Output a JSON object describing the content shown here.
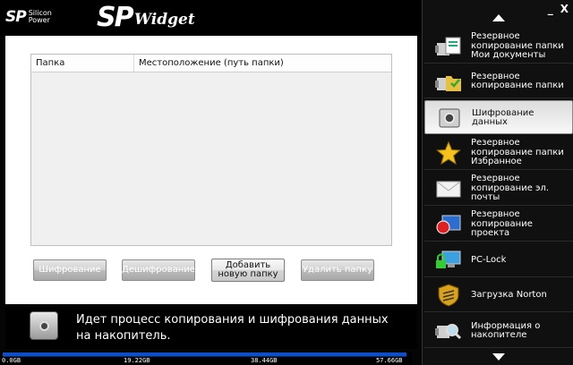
{
  "brand": {
    "logo": "SP",
    "logo_sub": "Silicon Power",
    "app_title": "SP",
    "app_title_widget": "Widget"
  },
  "window_controls": {
    "minimize": "_",
    "close": "X"
  },
  "table": {
    "columns": [
      "Папка",
      "Местоположение (путь папки)"
    ],
    "rows": []
  },
  "buttons": {
    "encrypt": "Шифрование",
    "decrypt": "Дешифрование",
    "add_folder": "Добавить новую папку",
    "delete_folder": "Удалить папку"
  },
  "status": {
    "message": "Идет процесс копирования и шифрования данных на накопитель."
  },
  "capacity": {
    "ticks": [
      "0.0GB",
      "19.22GB",
      "38.44GB",
      "57.66GB"
    ],
    "used_fraction": 0.98
  },
  "sidebar": {
    "items": [
      {
        "label": "Резервное копирование папки Мои документы",
        "icon": "usb-documents-icon"
      },
      {
        "label": "Резервное копирование папки",
        "icon": "usb-folder-icon"
      },
      {
        "label": "Шифрование данных",
        "icon": "safe-icon",
        "selected": true
      },
      {
        "label": "Резервное копирование папки Избранное",
        "icon": "star-icon"
      },
      {
        "label": "Резервное копирование эл. почты",
        "icon": "envelope-icon"
      },
      {
        "label": "Резервное копирование проекта",
        "icon": "project-icon"
      },
      {
        "label": "PC-Lock",
        "icon": "pc-lock-icon"
      },
      {
        "label": "Загрузка Norton",
        "icon": "norton-shield-icon"
      },
      {
        "label": "Информация о накопителе",
        "icon": "usb-magnifier-icon"
      }
    ]
  }
}
